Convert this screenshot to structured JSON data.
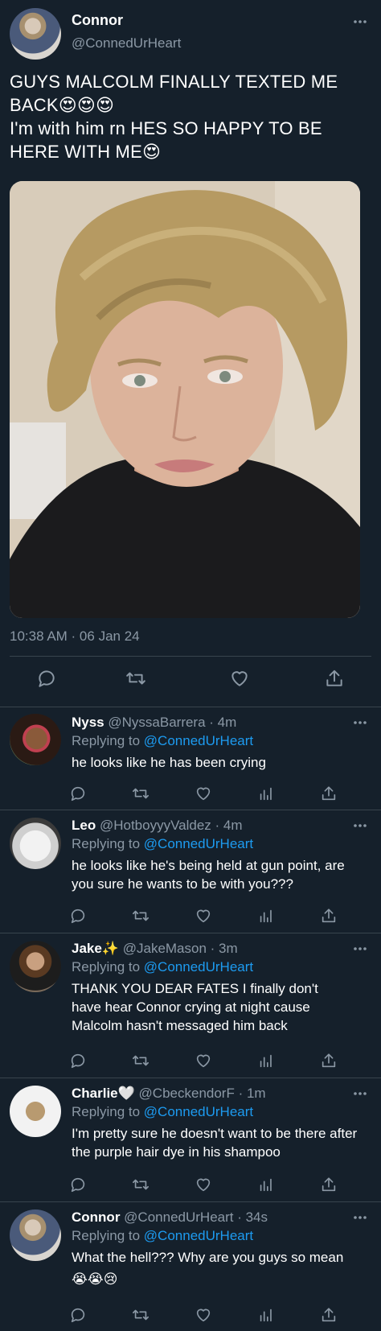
{
  "main_tweet": {
    "name": "Connor",
    "handle": "@ConnedUrHeart",
    "text_lines": [
      "GUYS MALCOLM FINALLY TEXTED ME",
      "BACK😍😍😍",
      "I'm with him rn  HES SO HAPPY TO BE",
      "HERE WITH ME😍"
    ],
    "timestamp": "10:38 AM · 06 Jan 24",
    "media": "photo"
  },
  "replies": [
    {
      "name": "Nyss",
      "handle": "@NyssaBarrera · 4m",
      "replying_label": "Replying to",
      "replying_to": "@ConnedUrHeart",
      "text": "he looks like he has been crying"
    },
    {
      "name": "Leo",
      "handle": "@HotboyyyValdez · 4m",
      "replying_label": "Replying to",
      "replying_to": "@ConnedUrHeart",
      "text": "he looks like he's being held at gun point, are you sure he wants to be with you???"
    },
    {
      "name": "Jake✨",
      "handle": "@JakeMason · 3m",
      "replying_label": "Replying to",
      "replying_to": "@ConnedUrHeart",
      "text": "THANK YOU DEAR FATES I finally don't have hear Connor crying at night cause Malcolm hasn't messaged him back"
    },
    {
      "name": "Charlie🤍",
      "handle": "@CbeckendorF · 1m",
      "replying_label": "Replying to",
      "replying_to": "@ConnedUrHeart",
      "text": "I'm pretty sure he doesn't want to be there after the purple hair dye in his shampoo"
    },
    {
      "name": "Connor",
      "handle": "@ConnedUrHeart · 34s",
      "replying_label": "Replying to",
      "replying_to": "@ConnedUrHeart",
      "text": "What the hell??? Why are you guys so mean",
      "text2": "😭😭😢"
    }
  ],
  "colors": {
    "background": "#15202b",
    "muted": "#8b98a5",
    "link": "#1d9bf0",
    "divider": "#38444d"
  },
  "icons": [
    "more-icon",
    "reply-icon",
    "retweet-icon",
    "like-icon",
    "analytics-icon",
    "share-icon"
  ]
}
